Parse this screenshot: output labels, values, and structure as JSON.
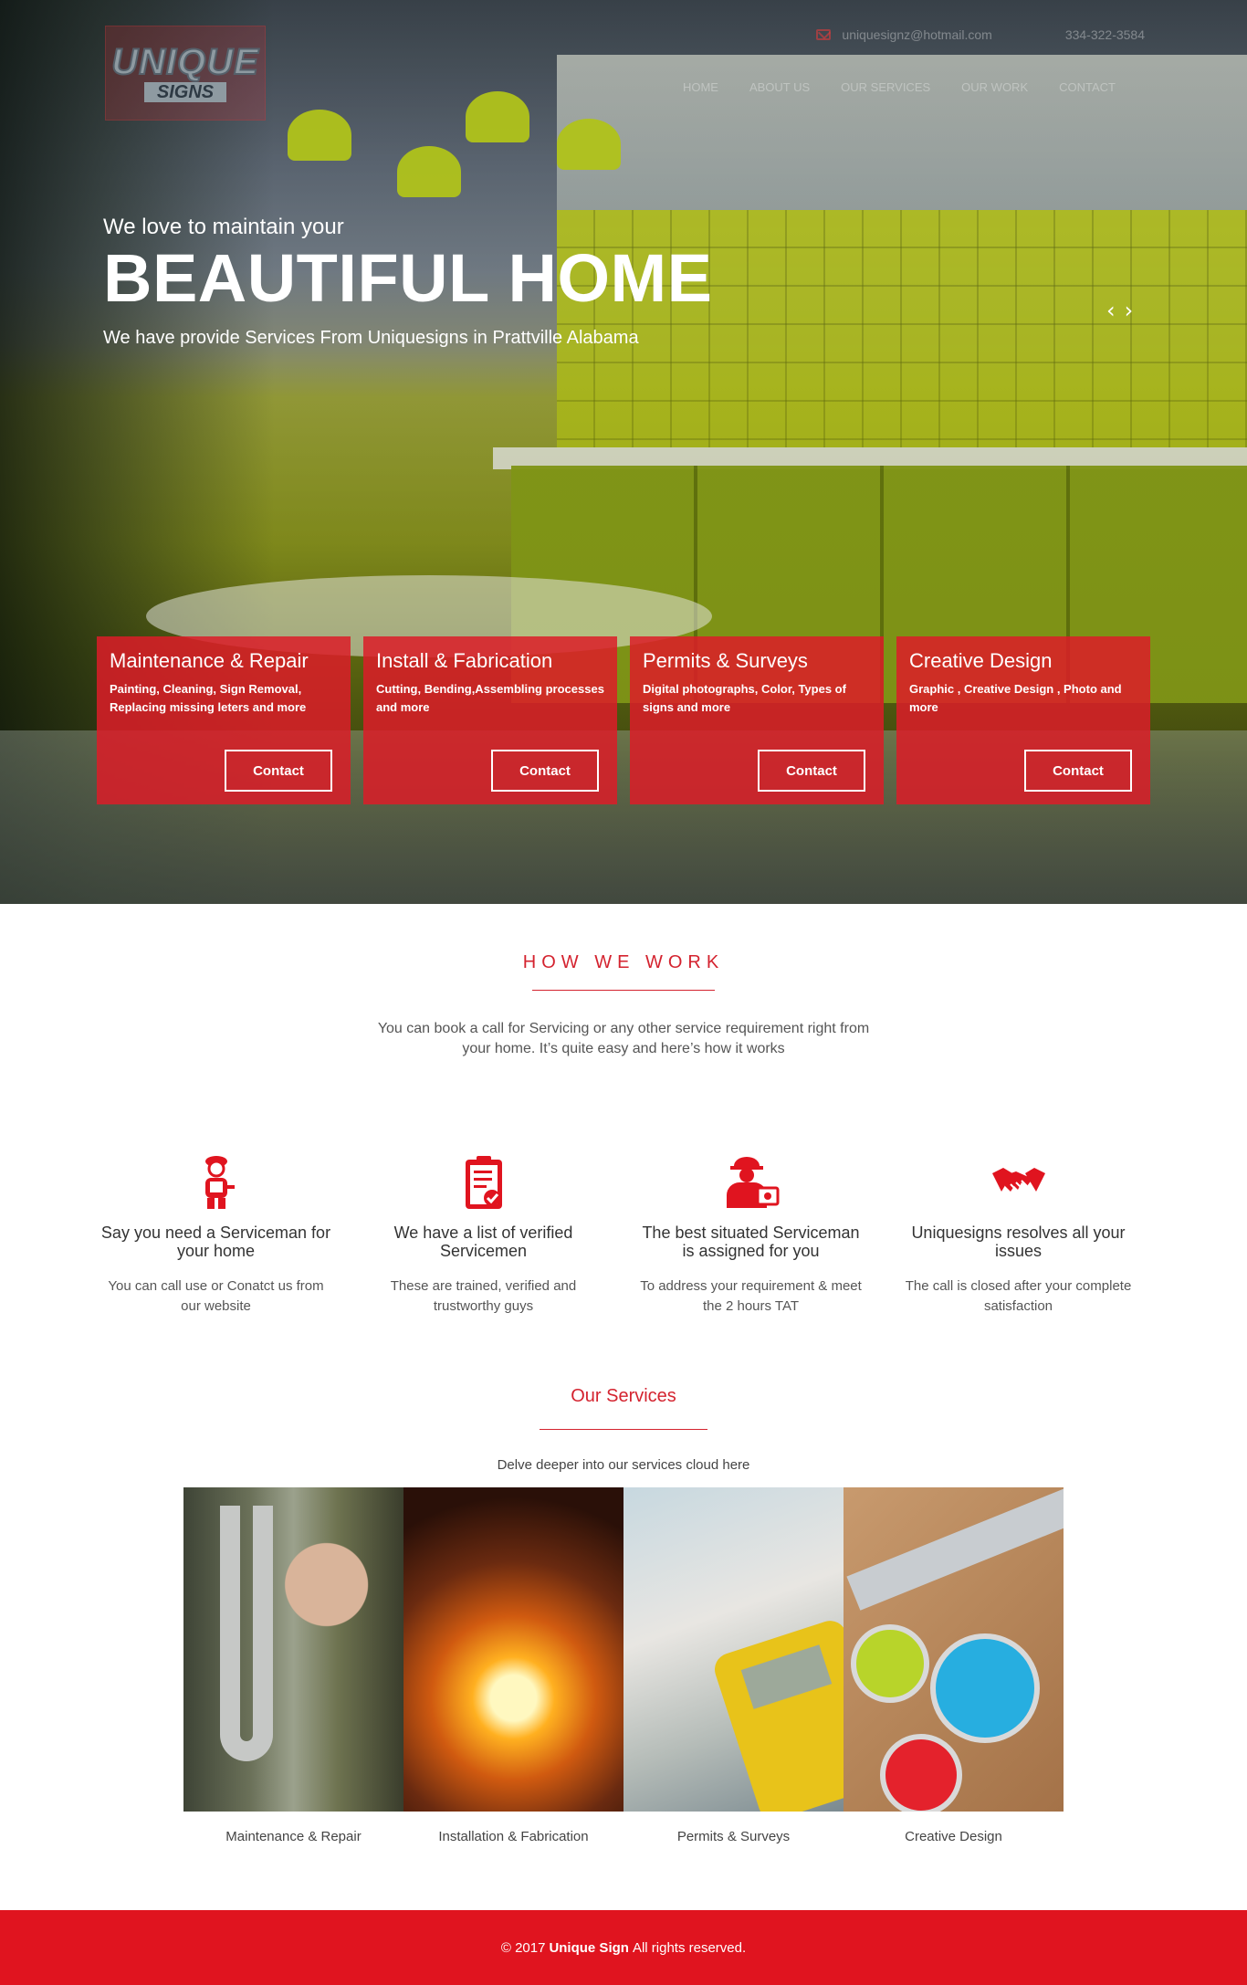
{
  "brand": {
    "logo_top": "UNIQUE",
    "logo_bottom": "SIGNS"
  },
  "topbar": {
    "email": "uniquesignz@hotmail.com",
    "phone": "334-322-3584"
  },
  "nav": {
    "items": [
      {
        "label": "HOME"
      },
      {
        "label": "ABOUT US"
      },
      {
        "label": "OUR SERVICES"
      },
      {
        "label": "OUR WORK"
      },
      {
        "label": "CONTACT"
      }
    ]
  },
  "hero": {
    "pre_title": "We love to maintain your",
    "title": "BEAUTIFUL HOME",
    "subtitle": "We have provide Services From Uniquesigns in Prattville Alabama",
    "prev_arrow": "‹",
    "next_arrow": "›"
  },
  "cards": [
    {
      "title": "Maintenance & Repair",
      "desc": "Painting, Cleaning, Sign Removal, Replacing missing leters and more",
      "button": "Contact"
    },
    {
      "title": "Install & Fabrication",
      "desc": "Cutting, Bending,Assembling processes and more",
      "button": "Contact"
    },
    {
      "title": "Permits & Surveys",
      "desc": "Digital photographs, Color, Types of signs and more",
      "button": "Contact"
    },
    {
      "title": "Creative Design",
      "desc": "Graphic , Creative Design , Photo and more",
      "button": "Contact"
    }
  ],
  "how": {
    "title": "HOW WE WORK",
    "description": "You can book a call for Servicing or any other service requirement right from your home. It’s quite easy and here’s how it works",
    "steps": [
      {
        "icon": "serviceman-icon",
        "title": "Say you need a Serviceman for your home",
        "text": "You can call use or Conatct us from our website"
      },
      {
        "icon": "clipboard-icon",
        "title": "We have a list of verified Servicemen",
        "text": "These are trained, verified and trustworthy guys"
      },
      {
        "icon": "worker-icon",
        "title": "The best situated Serviceman is assigned for you",
        "text": "To address your requirement & meet the 2 hours TAT"
      },
      {
        "icon": "handshake-icon",
        "title": "Uniquesigns resolves all your issues",
        "text": "The call is closed after your complete satisfaction"
      }
    ]
  },
  "services": {
    "title": "Our Services",
    "description": "Delve deeper into our services cloud here",
    "items": [
      {
        "caption": "Maintenance & Repair"
      },
      {
        "caption": "Installation & Fabrication"
      },
      {
        "caption": "Permits & Surveys"
      },
      {
        "caption": "Creative Design"
      }
    ]
  },
  "footer": {
    "prefix": "© 2017",
    "brand": "Unique Sign",
    "suffix": "All rights reserved."
  },
  "colors": {
    "accent": "#e0141f",
    "card": "#dc1c28"
  }
}
